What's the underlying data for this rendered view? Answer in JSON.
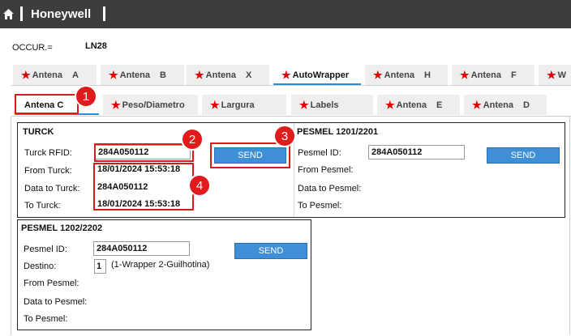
{
  "app": {
    "brand": "Honeywell"
  },
  "occur": {
    "label": "OCCUR.=",
    "value": "LN28"
  },
  "main_tabs": [
    {
      "star": "★",
      "label": "Antena",
      "suffix": "A"
    },
    {
      "star": "★",
      "label": "Antena",
      "suffix": "B"
    },
    {
      "star": "★",
      "label": "Antena",
      "suffix": "X"
    },
    {
      "star": "★",
      "label": "AutoWrapper",
      "suffix": ""
    },
    {
      "star": "★",
      "label": "Antena",
      "suffix": "H"
    },
    {
      "star": "★",
      "label": "Antena",
      "suffix": "F"
    },
    {
      "star": "★",
      "label": "W",
      "suffix": ""
    }
  ],
  "sub_tabs": [
    {
      "star": "",
      "label": "Antena C",
      "suffix": ""
    },
    {
      "star": "★",
      "label": "Peso/Diametro",
      "suffix": ""
    },
    {
      "star": "★",
      "label": "Largura",
      "suffix": ""
    },
    {
      "star": "★",
      "label": "Labels",
      "suffix": ""
    },
    {
      "star": "★",
      "label": "Antena",
      "suffix": "E"
    },
    {
      "star": "★",
      "label": "Antena",
      "suffix": "D"
    }
  ],
  "turck": {
    "title": "TURCK",
    "rfid_label": "Turck RFID:",
    "rfid_value": "284A050112",
    "send": "SEND",
    "from_label": "From Turck:",
    "from_value": "18/01/2024 15:53:18",
    "data_label": "Data to Turck:",
    "data_value": "284A050112",
    "to_label": "To Turck:",
    "to_value": "18/01/2024 15:53:18"
  },
  "pesmel1": {
    "title": "PESMEL 1201/2201",
    "id_label": "Pesmel ID:",
    "id_value": "284A050112",
    "send": "SEND",
    "from_label": "From Pesmel:",
    "data_label": "Data to Pesmel:",
    "to_label": "To Pesmel:"
  },
  "pesmel2": {
    "title": "PESMEL 1202/2202",
    "id_label": "Pesmel ID:",
    "id_value": "284A050112",
    "send": "SEND",
    "destino_label": "Destino:",
    "destino_value": "1",
    "destino_hint": "(1-Wrapper 2-Guilhotina)",
    "from_label": "From Pesmel:",
    "data_label": "Data to Pesmel:",
    "to_label": "To Pesmel:"
  },
  "badges": [
    "1",
    "2",
    "3",
    "4"
  ],
  "colors": {
    "topbar": "#3d3d3d",
    "star": "#e00000",
    "button": "#3e8fd6",
    "highlight": "#d71a1a",
    "active_tab_line": "#2a8cd6"
  }
}
